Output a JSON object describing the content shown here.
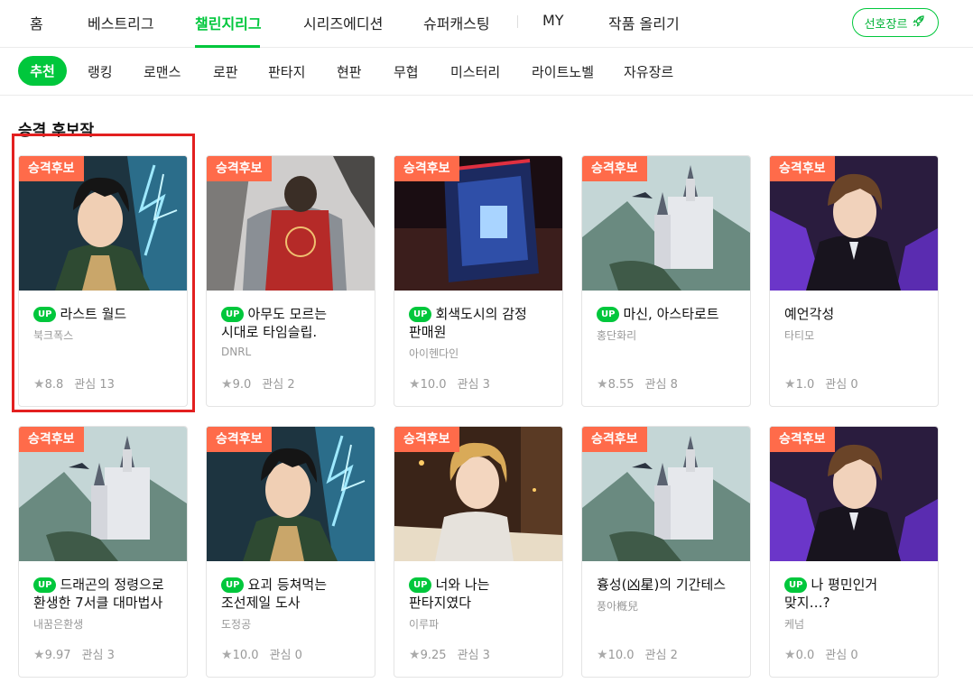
{
  "topnav": {
    "items": [
      "홈",
      "베스트리그",
      "챌린지리그",
      "시리즈에디션",
      "슈퍼캐스팅",
      "MY",
      "작품 올리기"
    ],
    "active_index": 2,
    "pref_button": "선호장르"
  },
  "genres": {
    "items": [
      "추천",
      "랭킹",
      "로맨스",
      "로판",
      "판타지",
      "현판",
      "무협",
      "미스터리",
      "라이트노벨",
      "자유장르"
    ],
    "active_index": 0
  },
  "section_title": "승격 후보작",
  "badge_label": "승격후보",
  "up_label": "UP",
  "interest_label": "관심",
  "colors": {
    "accent": "#00c73c",
    "badge": "#ff6b4a",
    "highlight": "#e32020"
  },
  "cards": [
    {
      "title": "라스트 월드",
      "up": true,
      "author": "북크폭스",
      "rating": "8.8",
      "interest": "13",
      "art": "hero-portrait"
    },
    {
      "title": "아무도 모르는 시대로 타임슬립.",
      "up": true,
      "author": "DNRL",
      "rating": "9.0",
      "interest": "2",
      "art": "knight-back"
    },
    {
      "title": "회색도시의 감정 판매원",
      "up": true,
      "author": "아이헨다인",
      "rating": "10.0",
      "interest": "3",
      "art": "magic-book"
    },
    {
      "title": "마신, 아스타로트",
      "up": true,
      "author": "홍단화리",
      "rating": "8.55",
      "interest": "8",
      "art": "castle"
    },
    {
      "title": "예언각성",
      "up": false,
      "author": "타티모",
      "rating": "1.0",
      "interest": "0",
      "art": "noble-portrait"
    },
    {
      "title": "드래곤의 정령으로 환생한 7서클 대마법사",
      "up": true,
      "author": "내꿈은환생",
      "rating": "9.97",
      "interest": "3",
      "art": "castle"
    },
    {
      "title": "요괴 등쳐먹는 조선제일 도사",
      "up": true,
      "author": "도정공",
      "rating": "10.0",
      "interest": "0",
      "art": "hero-portrait"
    },
    {
      "title": "너와 나는 판타지였다",
      "up": true,
      "author": "이루파",
      "rating": "9.25",
      "interest": "3",
      "art": "blond-reader"
    },
    {
      "title": "흉성(凶星)의 기간테스",
      "up": false,
      "author": "풍아槪兒",
      "rating": "10.0",
      "interest": "2",
      "art": "castle"
    },
    {
      "title": "나 평민인거 맞지…?",
      "up": true,
      "author": "케넘",
      "rating": "0.0",
      "interest": "0",
      "art": "noble-portrait"
    }
  ]
}
